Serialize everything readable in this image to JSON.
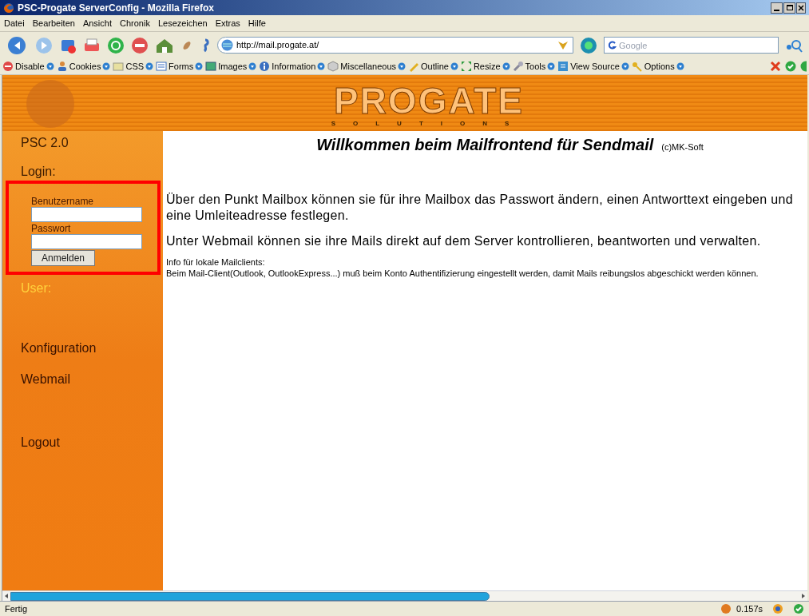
{
  "window": {
    "title": "PSC-Progate ServerConfig - Mozilla Firefox"
  },
  "menu": [
    {
      "label": "Datei"
    },
    {
      "label": "Bearbeiten"
    },
    {
      "label": "Ansicht"
    },
    {
      "label": "Chronik"
    },
    {
      "label": "Lesezeichen"
    },
    {
      "label": "Extras"
    },
    {
      "label": "Hilfe"
    }
  ],
  "address_bar": {
    "url": "http://mail.progate.at/"
  },
  "search": {
    "placeholder": "Google"
  },
  "dev_toolbar": [
    {
      "label": "Disable",
      "kind": "stop"
    },
    {
      "label": "Cookies",
      "kind": "person"
    },
    {
      "label": "CSS",
      "kind": "sheet"
    },
    {
      "label": "Forms",
      "kind": "form"
    },
    {
      "label": "Images",
      "kind": "image"
    },
    {
      "label": "Information",
      "kind": "info"
    },
    {
      "label": "Miscellaneous",
      "kind": "cube"
    },
    {
      "label": "Outline",
      "kind": "pen"
    },
    {
      "label": "Resize",
      "kind": "arrows"
    },
    {
      "label": "Tools",
      "kind": "wrench"
    },
    {
      "label": "View Source",
      "kind": "source"
    },
    {
      "label": "Options",
      "kind": "key"
    }
  ],
  "banner": {
    "logo": "PROGATE",
    "tagline": "SOLUTIONS"
  },
  "sidebar": {
    "version": "PSC 2.0",
    "login_heading": "Login:",
    "login_form": {
      "username_label": "Benutzername",
      "password_label": "Passwort",
      "submit": "Anmelden"
    },
    "user_label": "User:",
    "links": [
      {
        "label": "Konfiguration"
      },
      {
        "label": "Webmail"
      },
      {
        "label": "Logout"
      }
    ]
  },
  "content": {
    "heading": "Willkommen beim Mailfrontend für Sendmail",
    "copyright": "(c)MK-Soft",
    "paragraphs": [
      "Über den Punkt Mailbox können sie für ihre Mailbox das Passwort ändern, einen Antworttext eingeben und eine Umleiteadresse festlegen.",
      "Unter Webmail können sie ihre Mails direkt auf dem Server kontrollieren, beantworten und verwalten."
    ],
    "info_title": "Info für lokale Mailclients:",
    "info_text": "Beim Mail-Client(Outlook, OutlookExpress...) muß beim Konto Authentifizierung eingestellt werden, damit Mails reibungslos abgeschickt werden können."
  },
  "status_bar": {
    "text": "Fertig",
    "timing": "0.157s"
  }
}
